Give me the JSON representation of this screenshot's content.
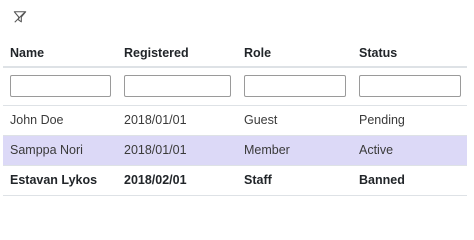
{
  "toolbar": {
    "filter_icon": "filter-icon"
  },
  "table": {
    "columns": [
      "Name",
      "Registered",
      "Role",
      "Status"
    ],
    "filters": [
      "",
      "",
      "",
      ""
    ],
    "rows": [
      {
        "name": "John Doe",
        "registered": "2018/01/01",
        "role": "Guest",
        "status": "Pending"
      },
      {
        "name": "Samppa Nori",
        "registered": "2018/01/01",
        "role": "Member",
        "status": "Active"
      },
      {
        "name": "Estavan Lykos",
        "registered": "2018/02/01",
        "role": "Staff",
        "status": "Banned"
      }
    ]
  },
  "colors": {
    "selected_row": "#dcd9f7",
    "border": "#dee2e6"
  }
}
